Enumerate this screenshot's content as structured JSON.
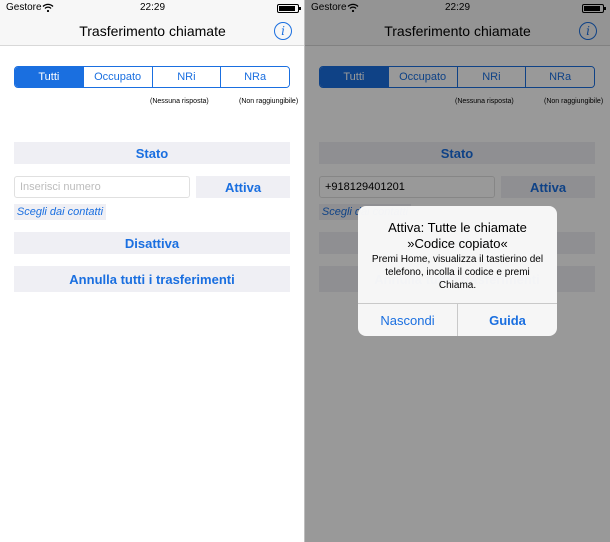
{
  "status_bar": {
    "carrier": "Gestore",
    "time": "22:29"
  },
  "nav": {
    "title": "Trasferimento chiamate",
    "info_icon": "info-icon"
  },
  "segments": [
    "Tutti",
    "Occupato",
    "NRi",
    "NRa"
  ],
  "sublabels": {
    "nri": "(Nessuna risposta)",
    "nra": "(Non raggiungibile)"
  },
  "buttons": {
    "stato": "Stato",
    "attiva": "Attiva",
    "contatti": "Scegli dai contatti",
    "disattiva": "Disattiva",
    "annulla": "Annulla tutti i trasferimenti"
  },
  "left": {
    "input_placeholder": "Inserisci numero"
  },
  "right": {
    "input_value": "+918129401201"
  },
  "alert": {
    "title_line1": "Attiva: Tutte le chiamate",
    "title_line2": "»Codice copiato«",
    "message": "Premi Home, visualizza il tastierino del telefono, incolla il codice e premi Chiama.",
    "dismiss": "Nascondi",
    "guide": "Guida"
  },
  "colors": {
    "accent": "#1a6fe0",
    "button_bg": "#efeff4",
    "bar_bg": "#f7f7f7"
  }
}
